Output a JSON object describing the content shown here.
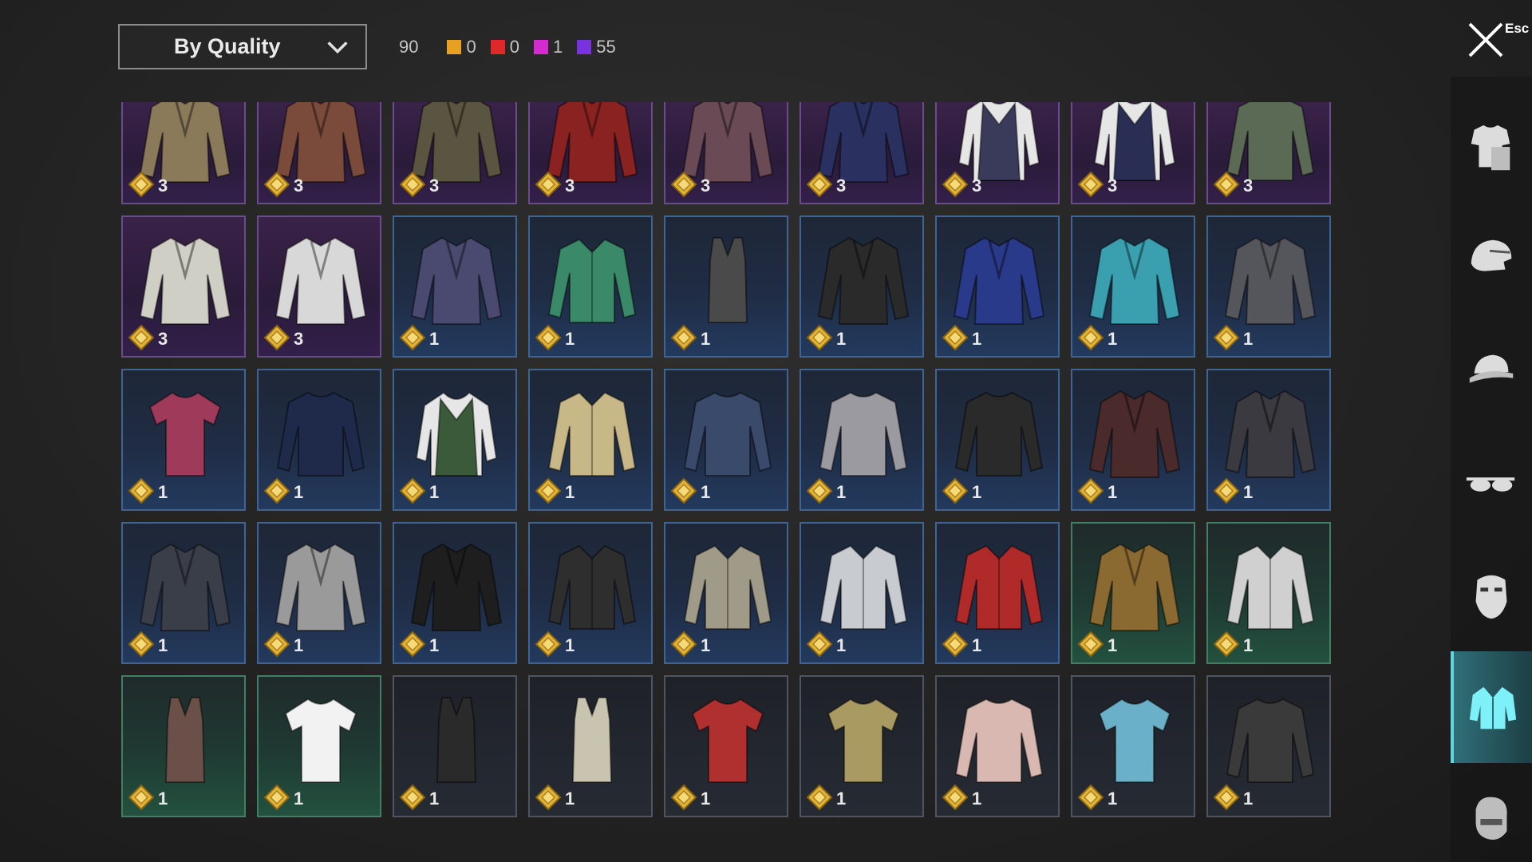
{
  "sort": {
    "label": "By Quality"
  },
  "counts": {
    "total": "90",
    "quality": [
      {
        "color": "#e8a020",
        "value": "0"
      },
      {
        "color": "#e02828",
        "value": "0"
      },
      {
        "color": "#d42ad0",
        "value": "1"
      },
      {
        "color": "#7a32e0",
        "value": "55"
      }
    ]
  },
  "close": {
    "esc_label": "Esc"
  },
  "sidebar": {
    "categories": [
      {
        "name": "outfit",
        "icon": "outfit-icon"
      },
      {
        "name": "helmet",
        "icon": "helmet-icon"
      },
      {
        "name": "hat",
        "icon": "cap-icon"
      },
      {
        "name": "glasses",
        "icon": "glasses-icon"
      },
      {
        "name": "mask",
        "icon": "mask-icon"
      },
      {
        "name": "top",
        "icon": "shirt-icon",
        "active": true
      },
      {
        "name": "face",
        "icon": "face-icon"
      }
    ]
  },
  "items": [
    {
      "rarity": "purple",
      "qty": "3",
      "color": "#8a7a5a",
      "kind": "jacket"
    },
    {
      "rarity": "purple",
      "qty": "3",
      "color": "#7a4a3a",
      "kind": "jacket"
    },
    {
      "rarity": "purple",
      "qty": "3",
      "color": "#5a5540",
      "kind": "jacket"
    },
    {
      "rarity": "purple",
      "qty": "3",
      "color": "#8a2222",
      "kind": "jacket"
    },
    {
      "rarity": "purple",
      "qty": "3",
      "color": "#6a4a55",
      "kind": "jacket"
    },
    {
      "rarity": "purple",
      "qty": "3",
      "color": "#2a3060",
      "kind": "jacket"
    },
    {
      "rarity": "purple",
      "qty": "3",
      "color": "#3a3a5a",
      "kind": "vest"
    },
    {
      "rarity": "purple",
      "qty": "3",
      "color": "#2a2e55",
      "kind": "vest"
    },
    {
      "rarity": "purple",
      "qty": "3",
      "color": "#5a6a55",
      "kind": "sweater"
    },
    {
      "rarity": "purple",
      "qty": "3",
      "color": "#cfcfc6",
      "kind": "jacket"
    },
    {
      "rarity": "purple",
      "qty": "3",
      "color": "#d8d8d8",
      "kind": "jacket"
    },
    {
      "rarity": "blue",
      "qty": "1",
      "color": "#4a4a70",
      "kind": "jacket"
    },
    {
      "rarity": "blue",
      "qty": "1",
      "color": "#3a8a6a",
      "kind": "shirt"
    },
    {
      "rarity": "blue",
      "qty": "1",
      "color": "#4a4a4a",
      "kind": "tank"
    },
    {
      "rarity": "blue",
      "qty": "1",
      "color": "#2a2a2a",
      "kind": "jacket"
    },
    {
      "rarity": "blue",
      "qty": "1",
      "color": "#2a3a8a",
      "kind": "jacket"
    },
    {
      "rarity": "blue",
      "qty": "1",
      "color": "#3aa0b0",
      "kind": "jacket"
    },
    {
      "rarity": "blue",
      "qty": "1",
      "color": "#55555c",
      "kind": "jacket"
    },
    {
      "rarity": "blue",
      "qty": "1",
      "color": "#a03a5a",
      "kind": "tshirt"
    },
    {
      "rarity": "blue",
      "qty": "1",
      "color": "#1f2a4a",
      "kind": "sweater"
    },
    {
      "rarity": "blue",
      "qty": "1",
      "color": "#3a5a3a",
      "kind": "vest"
    },
    {
      "rarity": "blue",
      "qty": "1",
      "color": "#c8b888",
      "kind": "shirt"
    },
    {
      "rarity": "blue",
      "qty": "1",
      "color": "#3a4a6a",
      "kind": "sweater"
    },
    {
      "rarity": "blue",
      "qty": "1",
      "color": "#9a9aa0",
      "kind": "sweater"
    },
    {
      "rarity": "blue",
      "qty": "1",
      "color": "#2a2a2a",
      "kind": "sweater"
    },
    {
      "rarity": "blue",
      "qty": "1",
      "color": "#4a2a2a",
      "kind": "jacket"
    },
    {
      "rarity": "blue",
      "qty": "1",
      "color": "#3a3a40",
      "kind": "jacket"
    },
    {
      "rarity": "blue",
      "qty": "1",
      "color": "#3a3e48",
      "kind": "jacket"
    },
    {
      "rarity": "blue",
      "qty": "1",
      "color": "#9a9a9a",
      "kind": "jacket"
    },
    {
      "rarity": "blue",
      "qty": "1",
      "color": "#1e1e1e",
      "kind": "jacket"
    },
    {
      "rarity": "blue",
      "qty": "1",
      "color": "#2e2e2e",
      "kind": "shirt"
    },
    {
      "rarity": "blue",
      "qty": "1",
      "color": "#a09a88",
      "kind": "shirt"
    },
    {
      "rarity": "blue",
      "qty": "1",
      "color": "#c8ccd0",
      "kind": "shirt"
    },
    {
      "rarity": "blue",
      "qty": "1",
      "color": "#b02a2a",
      "kind": "shirt"
    },
    {
      "rarity": "green",
      "qty": "1",
      "color": "#8a6a30",
      "kind": "jacket"
    },
    {
      "rarity": "green",
      "qty": "1",
      "color": "#d0d0d0",
      "kind": "shirt"
    },
    {
      "rarity": "green",
      "qty": "1",
      "color": "#6a5048",
      "kind": "tank"
    },
    {
      "rarity": "green",
      "qty": "1",
      "color": "#f2f2f2",
      "kind": "tshirt"
    },
    {
      "rarity": "gray",
      "qty": "1",
      "color": "#2a2a2a",
      "kind": "tank"
    },
    {
      "rarity": "gray",
      "qty": "1",
      "color": "#c8c4b0",
      "kind": "tank"
    },
    {
      "rarity": "gray",
      "qty": "1",
      "color": "#b03030",
      "kind": "tshirt"
    },
    {
      "rarity": "gray",
      "qty": "1",
      "color": "#a89a60",
      "kind": "tshirt"
    },
    {
      "rarity": "gray",
      "qty": "1",
      "color": "#d8b8b0",
      "kind": "sweater"
    },
    {
      "rarity": "gray",
      "qty": "1",
      "color": "#6ab0c8",
      "kind": "tshirt"
    },
    {
      "rarity": "gray",
      "qty": "1",
      "color": "#3a3a3a",
      "kind": "sweater"
    }
  ]
}
